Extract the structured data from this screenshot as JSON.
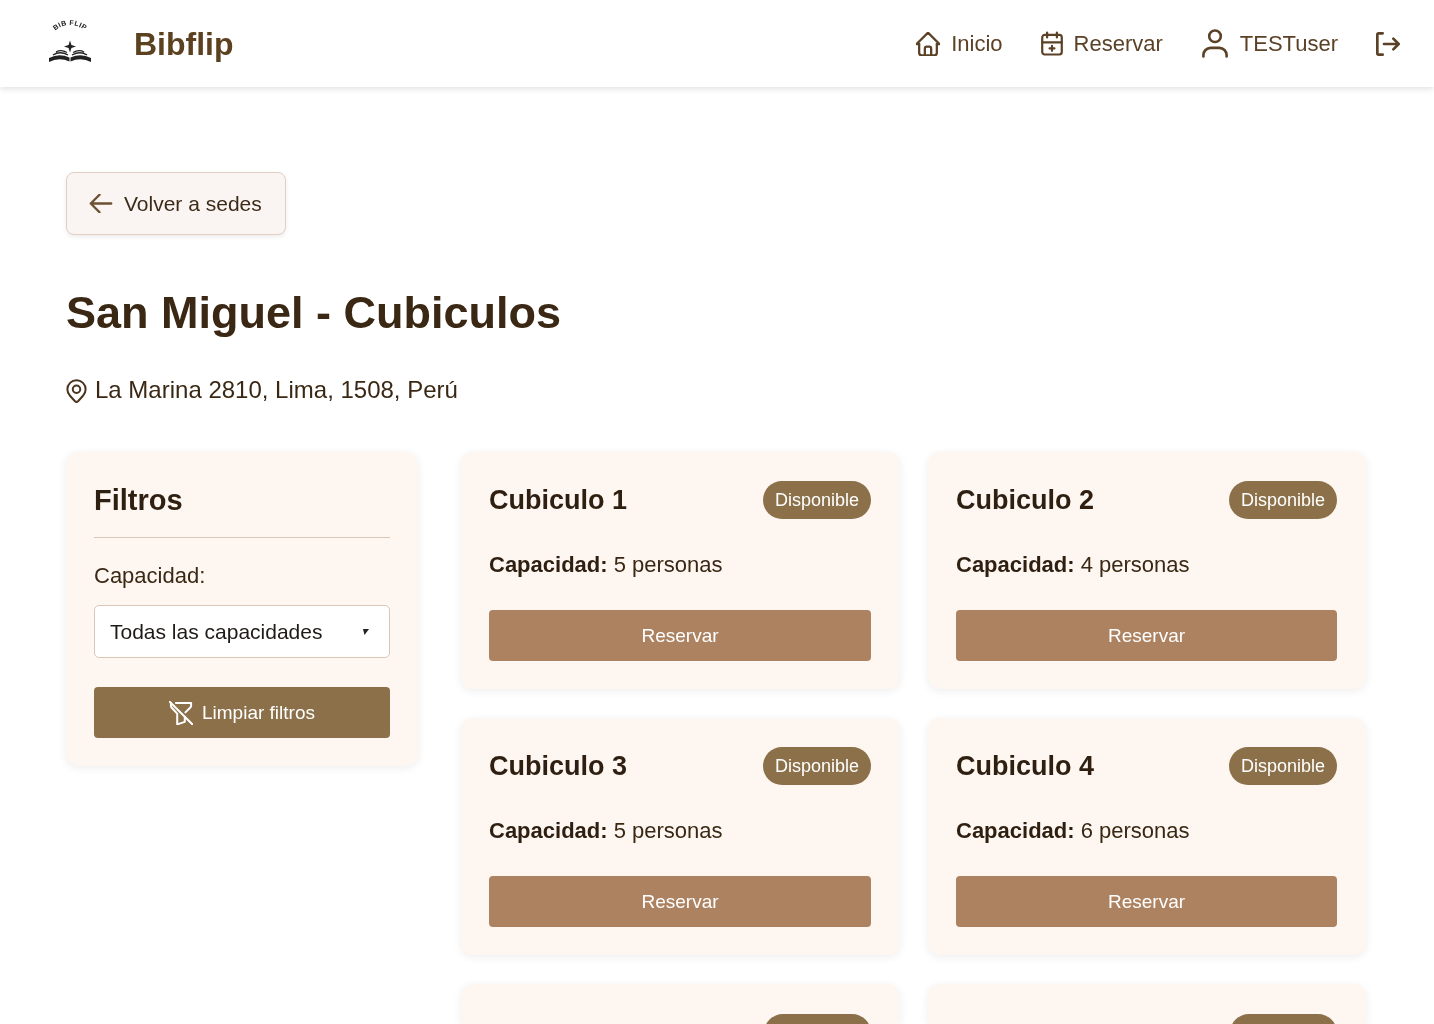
{
  "header": {
    "logo_text": "BIB FLIP",
    "brand": "Bibflip",
    "nav": [
      {
        "kind": "home",
        "label": "Inicio"
      },
      {
        "kind": "calendar",
        "label": "Reservar"
      },
      {
        "kind": "user",
        "label": "TESTuser"
      },
      {
        "kind": "logout"
      }
    ]
  },
  "back_button": {
    "label": "Volver a sedes"
  },
  "title": "San Miguel - Cubiculos",
  "address": "La Marina 2810, Lima, 1508, Perú",
  "filters": {
    "title": "Filtros",
    "capacity_label": "Capacidad:",
    "capacity_select": {
      "value": "Todas las capacidades"
    },
    "clear_button": "Limpiar filtros"
  },
  "rooms": [
    {
      "name": "Cubiculo 1",
      "status": "Disponible",
      "capacity": "**Capacidad:** 5 personas",
      "button": "Reservar"
    },
    {
      "name": "Cubiculo 2",
      "status": "Disponible",
      "capacity": "**Capacidad:** 4 personas",
      "button": "Reservar"
    },
    {
      "name": "Cubiculo 3",
      "status": "Disponible",
      "capacity": "**Capacidad:** 5 personas",
      "button": "Reservar"
    },
    {
      "name": "Cubiculo 4",
      "status": "Disponible",
      "capacity": "**Capacidad:** 6 personas",
      "button": "Reservar"
    }
  ],
  "partial_rooms": [
    {
      "badge": true
    },
    {
      "badge": true
    }
  ]
}
